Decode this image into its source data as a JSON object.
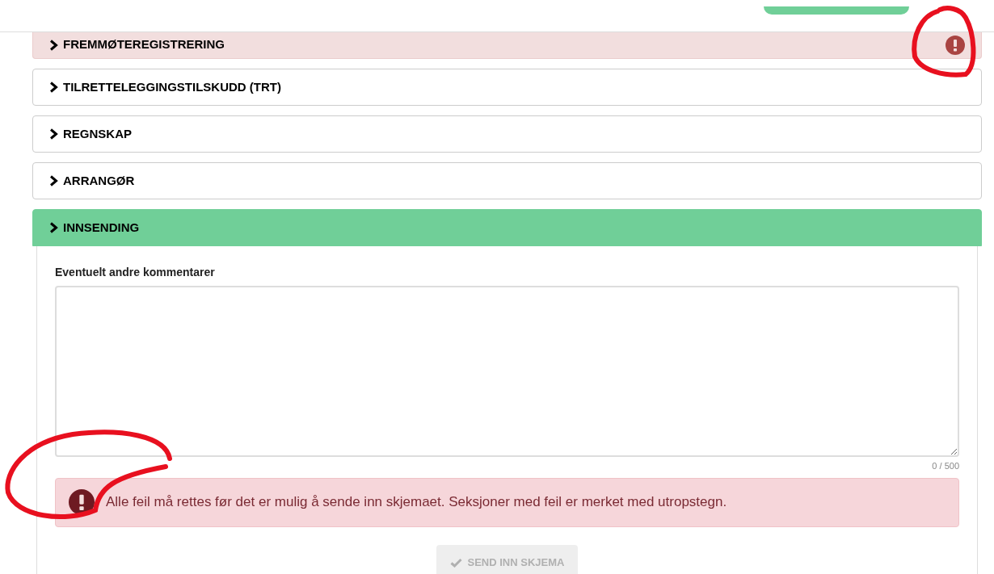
{
  "sections": [
    {
      "title": "FREMMØTEREGISTRERING",
      "error": true,
      "selected": false,
      "expanded": false
    },
    {
      "title": "TILRETTELEGGINGSTILSKUDD (TRT)",
      "error": false,
      "selected": false,
      "expanded": false
    },
    {
      "title": "REGNSKAP",
      "error": false,
      "selected": false,
      "expanded": false
    },
    {
      "title": "ARRANGØR",
      "error": false,
      "selected": false,
      "expanded": false
    },
    {
      "title": "INNSENDING",
      "error": false,
      "selected": true,
      "expanded": true
    }
  ],
  "submission": {
    "comment_label": "Eventuelt andre kommentarer",
    "counter": "0 / 500",
    "alert": "Alle feil må rettes før det er mulig å sende inn skjemaet. Seksjoner med feil er merket med utropstegn.",
    "submit_button": {
      "label": "SEND INN SKJEMA",
      "disabled": true
    }
  }
}
